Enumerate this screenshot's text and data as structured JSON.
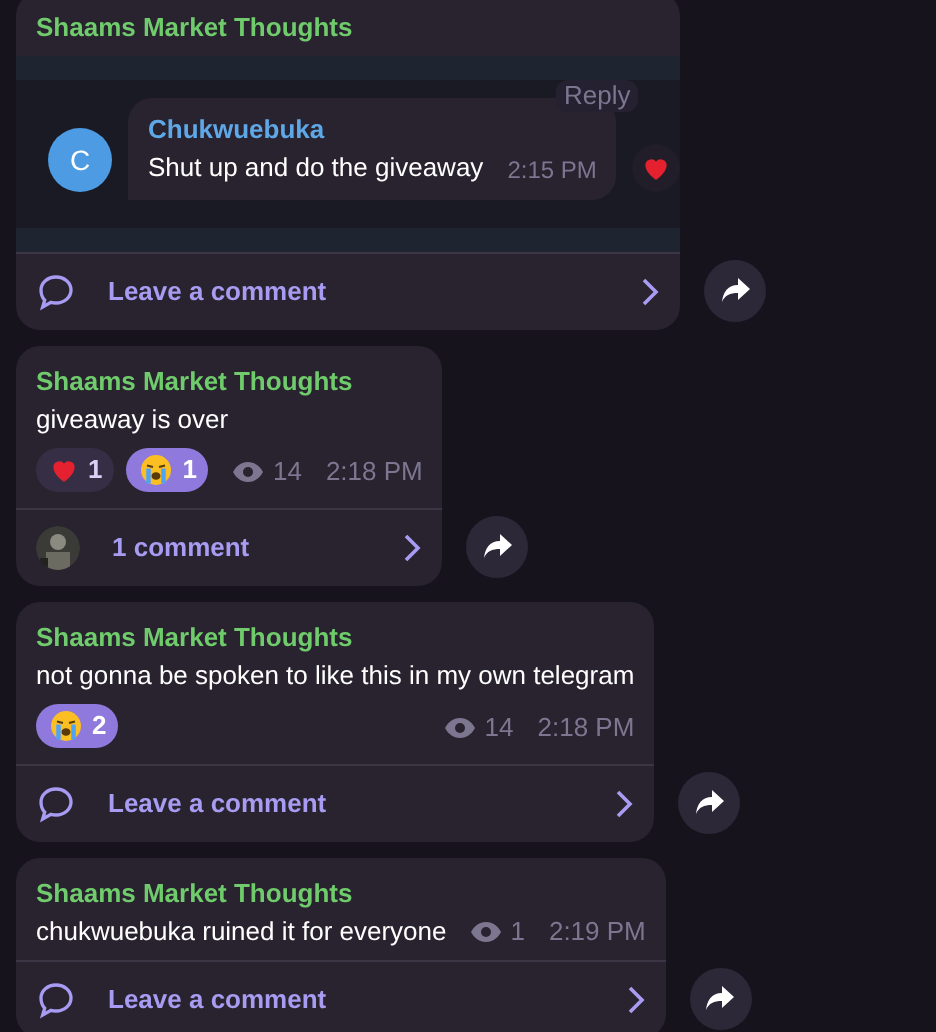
{
  "posts": [
    {
      "author": "Shaams Market Thoughts",
      "embed": {
        "reply_label": "Reply",
        "avatar_letter": "C",
        "name": "Chukwuebuka",
        "text": "Shut up and do the giveaway",
        "time": "2:15 PM",
        "reaction": {
          "kind": "heart"
        }
      },
      "comments": {
        "label": "Leave a comment",
        "avatar": false
      }
    },
    {
      "author": "Shaams Market Thoughts",
      "text": "giveaway is over",
      "reactions": [
        {
          "kind": "heart",
          "count": "1",
          "selected": false
        },
        {
          "kind": "sob",
          "count": "1",
          "selected": true
        }
      ],
      "views": "14",
      "time": "2:18 PM",
      "comments": {
        "label": "1 comment",
        "avatar": true
      }
    },
    {
      "author": "Shaams Market Thoughts",
      "text": "not gonna be spoken to like this in my own telegram",
      "reactions": [
        {
          "kind": "sob",
          "count": "2",
          "selected": true
        }
      ],
      "views": "14",
      "time": "2:18 PM",
      "comments": {
        "label": "Leave a comment",
        "avatar": false
      }
    },
    {
      "author": "Shaams Market Thoughts",
      "text": "chukwuebuka ruined it for everyone",
      "views": "1",
      "time": "2:19 PM",
      "comments": {
        "label": "Leave a comment",
        "avatar": false
      }
    }
  ]
}
